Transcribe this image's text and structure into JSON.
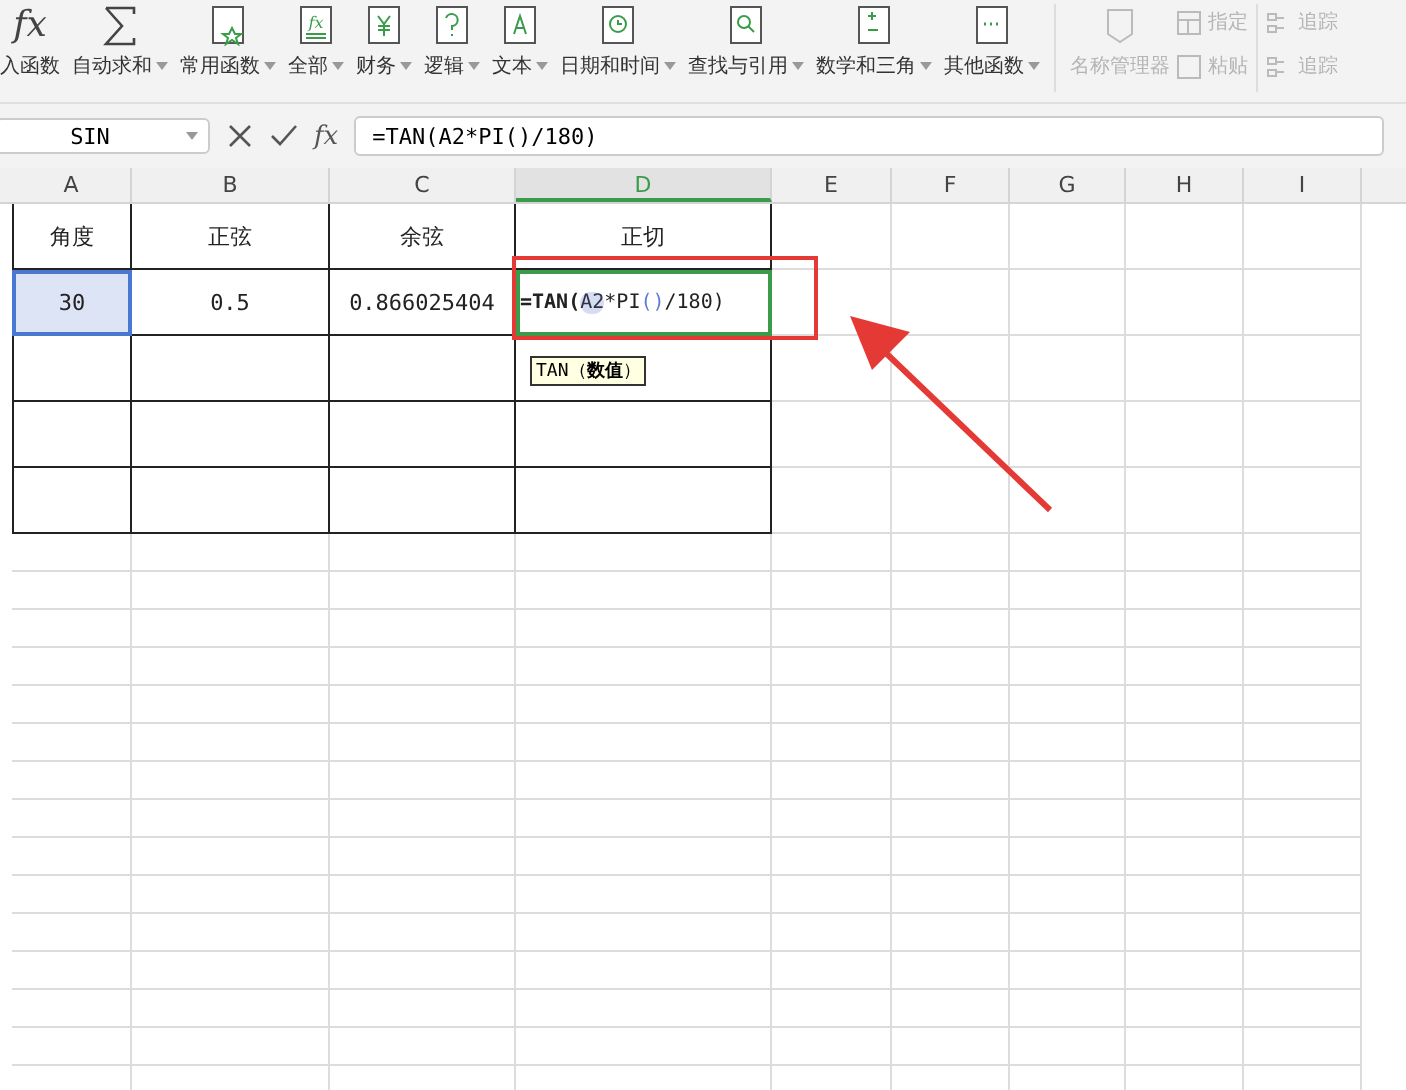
{
  "ribbon": {
    "items": [
      {
        "label": "入函数",
        "dropdown": false,
        "icon_text": "fx"
      },
      {
        "label": "自动求和",
        "dropdown": true
      },
      {
        "label": "常用函数",
        "dropdown": true
      },
      {
        "label": "全部",
        "dropdown": true,
        "icon_text": "fx"
      },
      {
        "label": "财务",
        "dropdown": true
      },
      {
        "label": "逻辑",
        "dropdown": true
      },
      {
        "label": "文本",
        "dropdown": true
      },
      {
        "label": "日期和时间",
        "dropdown": true
      },
      {
        "label": "查找与引用",
        "dropdown": true
      },
      {
        "label": "数学和三角",
        "dropdown": true
      },
      {
        "label": "其他函数",
        "dropdown": true
      }
    ],
    "name_manager": {
      "label": "名称管理器",
      "disabled": true
    },
    "small_items": [
      {
        "label": "指定",
        "disabled": true
      },
      {
        "label": "粘贴",
        "disabled": true
      }
    ],
    "trace_items": [
      {
        "label": "追踪",
        "disabled": true
      },
      {
        "label": "追踪",
        "disabled": true
      }
    ]
  },
  "formula_bar": {
    "name_box": "SIN",
    "fx": "fx",
    "value": "=TAN(A2*PI()/180)"
  },
  "columns": [
    {
      "label": "A",
      "selected": false
    },
    {
      "label": "B",
      "selected": false
    },
    {
      "label": "C",
      "selected": false
    },
    {
      "label": "D",
      "selected": true
    },
    {
      "label": "E",
      "selected": false
    },
    {
      "label": "F",
      "selected": false
    },
    {
      "label": "G",
      "selected": false
    },
    {
      "label": "H",
      "selected": false
    },
    {
      "label": "I",
      "selected": false
    }
  ],
  "rows": [
    {
      "cells": [
        {
          "text": "角度",
          "highlighted": false
        },
        {
          "text": "正弦",
          "highlighted": false
        },
        {
          "text": "余弦",
          "highlighted": false
        },
        {
          "text": "正切",
          "highlighted": false
        }
      ]
    },
    {
      "cells": [
        {
          "text": "30",
          "highlighted": true
        },
        {
          "text": "0.5",
          "highlighted": false
        },
        {
          "text": "0.866025404",
          "highlighted": false
        },
        {
          "editing": true,
          "segments": [
            {
              "kind": "func",
              "text": "=TAN("
            },
            {
              "kind": "ref",
              "text": "A2"
            },
            {
              "kind": "plain",
              "text": "*PI"
            },
            {
              "kind": "paren",
              "text": "()"
            },
            {
              "kind": "plain",
              "text": "/180)"
            }
          ]
        }
      ]
    },
    {
      "cells": []
    },
    {
      "cells": []
    },
    {
      "cells": []
    }
  ],
  "tooltip": "TAN（**数值**）"
}
